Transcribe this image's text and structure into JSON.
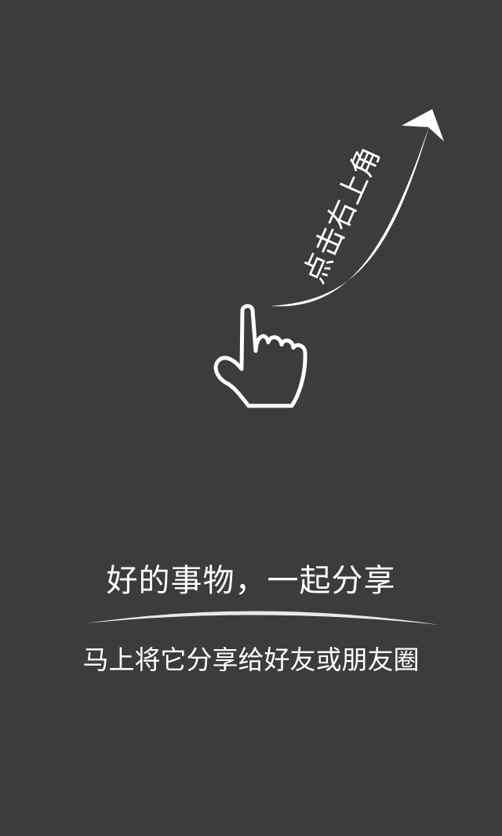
{
  "guide": {
    "arrow_text": "点击右上角",
    "icons": {
      "arrow": "curved-arrow-up-right-icon",
      "hand": "pointing-hand-icon"
    }
  },
  "share": {
    "headline": "好的事物，一起分享",
    "subtitle": "马上将它分享给好友或朋友圈"
  },
  "colors": {
    "background": "#3d3c3b",
    "foreground": "#ffffff"
  }
}
